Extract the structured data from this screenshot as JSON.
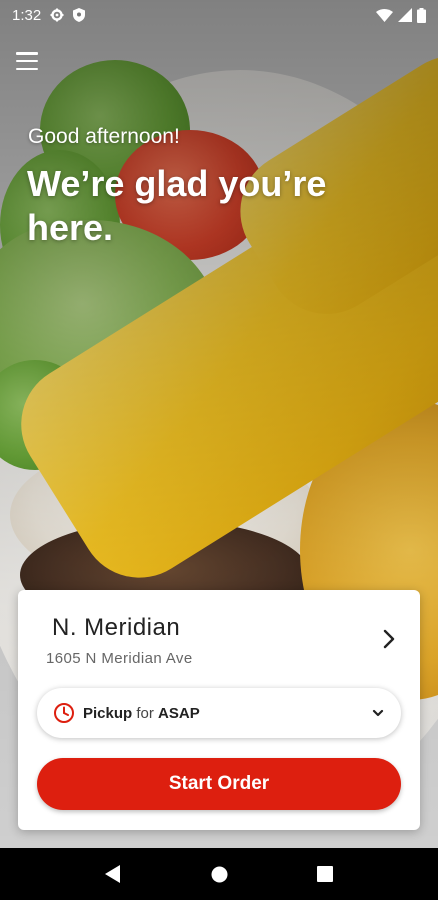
{
  "status_bar": {
    "time": "1:32",
    "icons": [
      "gear-icon",
      "shield-icon",
      "wifi-icon",
      "signal-icon",
      "battery-icon"
    ]
  },
  "header": {
    "menu_icon": "hamburger-menu-icon"
  },
  "hero": {
    "greeting": "Good afternoon!",
    "headline": "We’re glad you’re here."
  },
  "location": {
    "name": "N. Meridian",
    "address": "1605 N Meridian Ave",
    "chevron_icon": "chevron-right-icon"
  },
  "order_mode": {
    "icon": "clock-icon",
    "mode": "Pickup",
    "connector": "for",
    "time": "ASAP",
    "dropdown_icon": "chevron-down-icon"
  },
  "cta": {
    "label": "Start Order"
  },
  "nav_bar": {
    "icons": [
      "back-icon",
      "home-icon",
      "recents-icon"
    ]
  },
  "colors": {
    "accent": "#dd1f0f",
    "card_bg": "#ffffff",
    "nav_bg": "#000000"
  }
}
